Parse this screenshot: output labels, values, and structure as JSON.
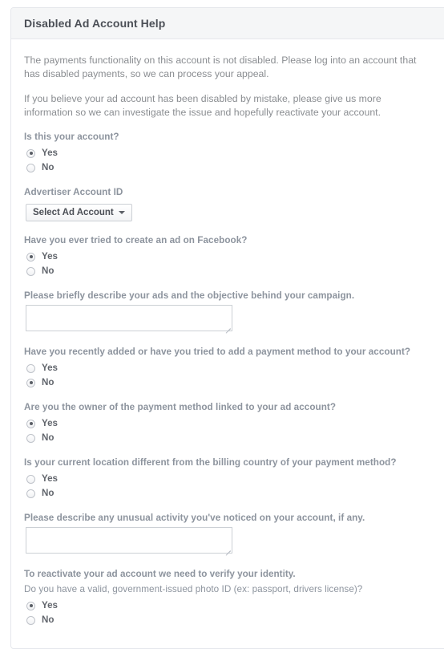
{
  "card": {
    "title": "Disabled Ad Account Help"
  },
  "intro": {
    "paragraph_1": "The payments functionality on this account is not disabled. Please log into an account that has disabled payments, so we can process your appeal.",
    "paragraph_2": "If you believe your ad account has been disabled by mistake, please give us more information so we can investigate the issue and hopefully reactivate your account."
  },
  "options": {
    "yes": "Yes",
    "no": "No"
  },
  "questions": {
    "is_this_your_account": {
      "label": "Is this your account?",
      "selected": "Yes"
    },
    "advertiser_account_id": {
      "label": "Advertiser Account ID",
      "select_value": "Select Ad Account"
    },
    "ever_tried_create_ad": {
      "label": "Have you ever tried to create an ad on Facebook?",
      "selected": "Yes"
    },
    "describe_ads": {
      "label": "Please briefly describe your ads and the objective behind your campaign.",
      "value": "",
      "placeholder": ""
    },
    "recently_added_payment": {
      "label": "Have you recently added or have you tried to add a payment method to your account?",
      "selected": "No"
    },
    "owner_of_payment_method": {
      "label": "Are you the owner of the payment method linked to your ad account?",
      "selected": "Yes"
    },
    "location_different": {
      "label": "Is your current location different from the billing country of your payment method?",
      "selected": ""
    },
    "unusual_activity": {
      "label": "Please describe any unusual activity you've noticed on your account, if any.",
      "value": "",
      "placeholder": ""
    },
    "identity_heading": "To reactivate your ad account we need to verify your identity.",
    "has_photo_id": {
      "label": "Do you have a valid, government-issued photo ID (ex: passport, drivers license)?",
      "selected": "Yes"
    }
  },
  "icons": {
    "caret": "chevron-down-icon",
    "resize": "resize-grip-icon"
  },
  "colors": {
    "header_bg": "#f5f6f7",
    "border": "#e5e7ec",
    "title_text": "#4b4f56",
    "body_text": "#8a8d91",
    "label_text": "#8d949e",
    "option_text": "#62666d"
  }
}
